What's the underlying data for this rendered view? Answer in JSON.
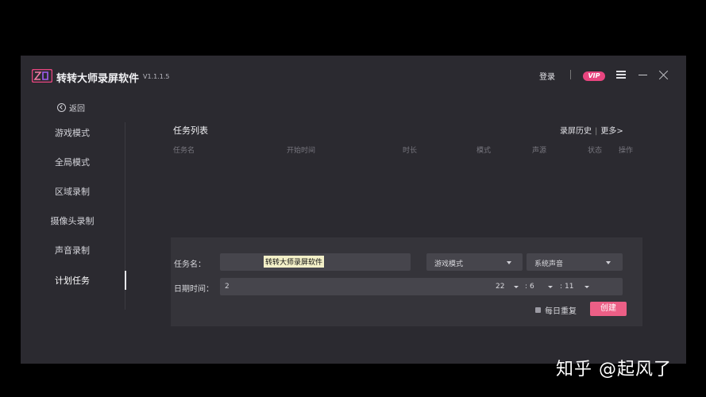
{
  "app": {
    "title": "转转大师录屏软件",
    "version": "V1.1.1.5",
    "login": "登录",
    "vip": "VIP"
  },
  "sidebar": {
    "back": "返回",
    "items": [
      {
        "label": "游戏模式"
      },
      {
        "label": "全局模式"
      },
      {
        "label": "区域录制"
      },
      {
        "label": "摄像头录制"
      },
      {
        "label": "声音录制"
      },
      {
        "label": "计划任务"
      }
    ],
    "active_index": 5
  },
  "task_list": {
    "title": "任务列表",
    "history": "录屏历史",
    "more": "更多>",
    "columns": [
      "任务名",
      "开始时间",
      "时长",
      "模式",
      "声源",
      "状态",
      "操作"
    ]
  },
  "form": {
    "name_label": "任务名：",
    "name_value": "转转大师录屏软件",
    "mode": "游戏模式",
    "audio": "系统声音",
    "date_label": "日期时间：",
    "date_value": "2",
    "hour": "22",
    "minute": "6",
    "second": "11",
    "repeat_label": "每日重复",
    "create": "创建"
  },
  "watermark": "知乎 @起风了",
  "colors": {
    "accent": "#ec5f86",
    "vip": "#e8457f",
    "window_bg": "#2b2a30",
    "panel_bg": "#35343a"
  }
}
